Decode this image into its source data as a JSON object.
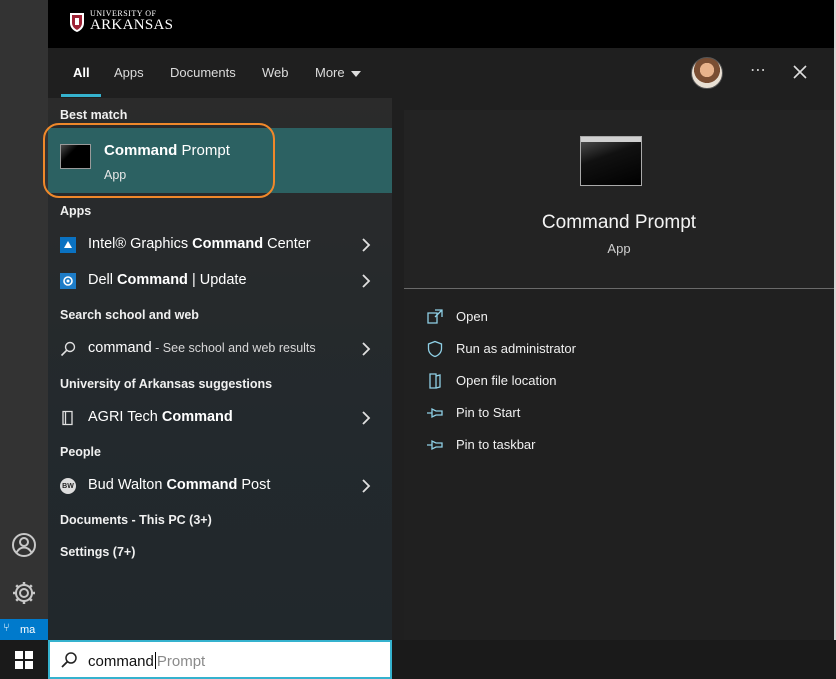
{
  "banner": {
    "logo_top": "UNIVERSITY OF",
    "logo_bottom": "ARKANSAS"
  },
  "left_strip": {
    "status_text": "ma"
  },
  "tabs": [
    {
      "label": "All",
      "active": true
    },
    {
      "label": "Apps"
    },
    {
      "label": "Documents"
    },
    {
      "label": "Web"
    },
    {
      "label": "More"
    }
  ],
  "header_icons": {
    "avatar": "user-avatar",
    "more": "⋯",
    "close": "close-icon"
  },
  "results": {
    "best_match_heading": "Best match",
    "best_match": {
      "title_bold": "Command",
      "title_rest": " Prompt",
      "subtitle": "App",
      "icon": "command-prompt-icon"
    },
    "apps_heading": "Apps",
    "apps": [
      {
        "pre": "Intel® Graphics ",
        "bold": "Command",
        "post": " Center",
        "icon": "intel-graphics-icon"
      },
      {
        "pre": "Dell ",
        "bold": "Command",
        "post": " | Update",
        "icon": "dell-update-icon"
      }
    ],
    "web_heading": "Search school and web",
    "web": {
      "query": "command",
      "suffix": " - See school and web results",
      "icon": "search-icon"
    },
    "uark_heading": "University of Arkansas suggestions",
    "uark": {
      "pre": "AGRI Tech ",
      "bold": "Command",
      "post": "",
      "icon": "book-icon"
    },
    "people_heading": "People",
    "people": {
      "pre": "Bud Walton ",
      "bold": "Command",
      "post": " Post",
      "initials": "BW"
    },
    "documents_heading": "Documents - This PC (3+)",
    "settings_heading": "Settings (7+)"
  },
  "detail": {
    "title": "Command Prompt",
    "subtitle": "App",
    "actions": [
      {
        "label": "Open",
        "icon": "open-icon"
      },
      {
        "label": "Run as administrator",
        "icon": "shield-icon"
      },
      {
        "label": "Open file location",
        "icon": "file-location-icon"
      },
      {
        "label": "Pin to Start",
        "icon": "pin-icon"
      },
      {
        "label": "Pin to taskbar",
        "icon": "pin-icon"
      }
    ]
  },
  "search": {
    "typed": "command",
    "completion": "Prompt"
  },
  "colors": {
    "accent": "#35b2ce",
    "highlight": "#f0882a",
    "selected": "#2c6162"
  }
}
